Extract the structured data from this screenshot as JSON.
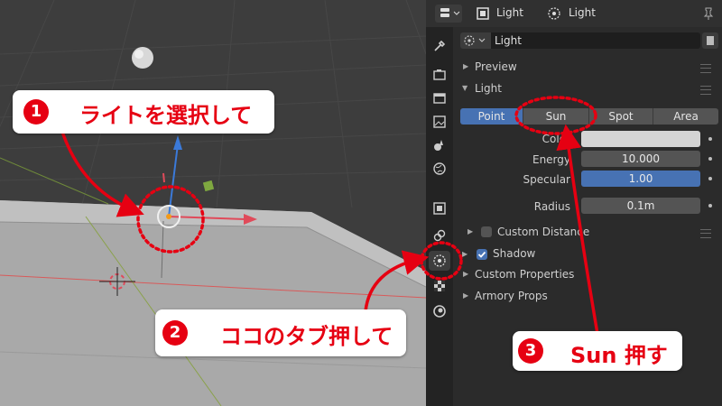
{
  "header": {
    "object_label": "Light",
    "data_label": "Light"
  },
  "datablock": {
    "name": "Light"
  },
  "panels": {
    "preview": "Preview",
    "light": "Light",
    "custom_distance": "Custom Distance",
    "shadow": "Shadow",
    "custom_properties": "Custom Properties",
    "armory_props": "Armory Props"
  },
  "light_types": [
    "Point",
    "Sun",
    "Spot",
    "Area"
  ],
  "light_type_selected": "Point",
  "fields": {
    "color_label": "Color",
    "energy_label": "Energy",
    "energy_value": "10.000",
    "specular_label": "Specular",
    "specular_value": "1.00",
    "radius_label": "Radius",
    "radius_value": "0.1m"
  },
  "shadow_checked": true,
  "custom_distance_checked": false,
  "annotations": {
    "step1_number": "1",
    "step1_text": "ライトを選択して",
    "step2_number": "2",
    "step2_text": "ココのタブ押して",
    "step3_number": "3",
    "step3_text": "Sun 押す"
  },
  "colors": {
    "accent_red": "#e60012",
    "selected_blue": "#4772b3",
    "panel_bg": "#2b2b2b"
  }
}
